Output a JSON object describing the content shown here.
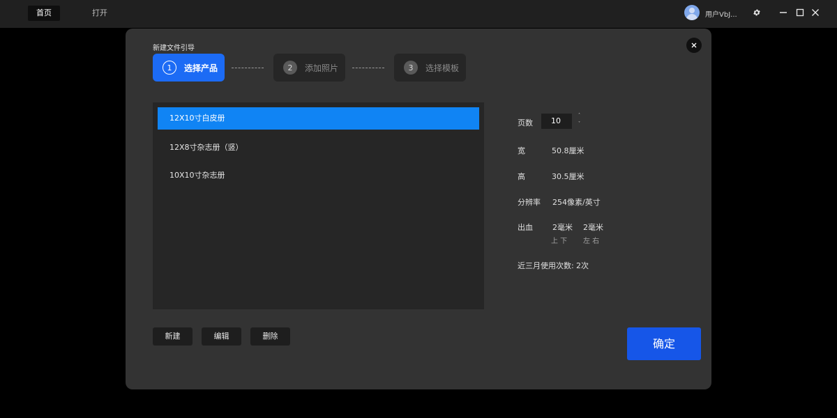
{
  "topbar": {
    "tabs": [
      {
        "label": "首页"
      },
      {
        "label": "打开"
      }
    ],
    "username": "用户VbJ..."
  },
  "dialog": {
    "title": "新建文件引导",
    "steps": [
      {
        "number": "1",
        "label": "选择产品"
      },
      {
        "number": "2",
        "label": "添加照片"
      },
      {
        "number": "3",
        "label": "选择模板"
      }
    ],
    "products": [
      {
        "label": "12X10寸白皮册"
      },
      {
        "label": "12X8寸杂志册（竖）"
      },
      {
        "label": "10X10寸杂志册"
      }
    ],
    "properties": {
      "pages_label": "页数",
      "pages_value": "10",
      "spin_up": "˄",
      "spin_down": "˅",
      "width_label": "宽",
      "width_value": "50.8厘米",
      "height_label": "高",
      "height_value": "30.5厘米",
      "resolution_label": "分辨率",
      "resolution_value": "254像素/英寸",
      "bleed_label": "出血",
      "bleed_vertical": "2毫米",
      "bleed_horizontal": "2毫米",
      "bleed_vertical_sub": "上 下",
      "bleed_horizontal_sub": "左 右",
      "usage_label": "近三月使用次数:",
      "usage_value": "2次"
    },
    "buttons": {
      "new": "新建",
      "edit": "编辑",
      "delete": "删除",
      "confirm": "确定"
    }
  },
  "colors": {
    "accent": "#1c6bf5",
    "selected_row": "#1084f4",
    "confirm": "#1656e8",
    "dialog_bg": "#333333"
  }
}
